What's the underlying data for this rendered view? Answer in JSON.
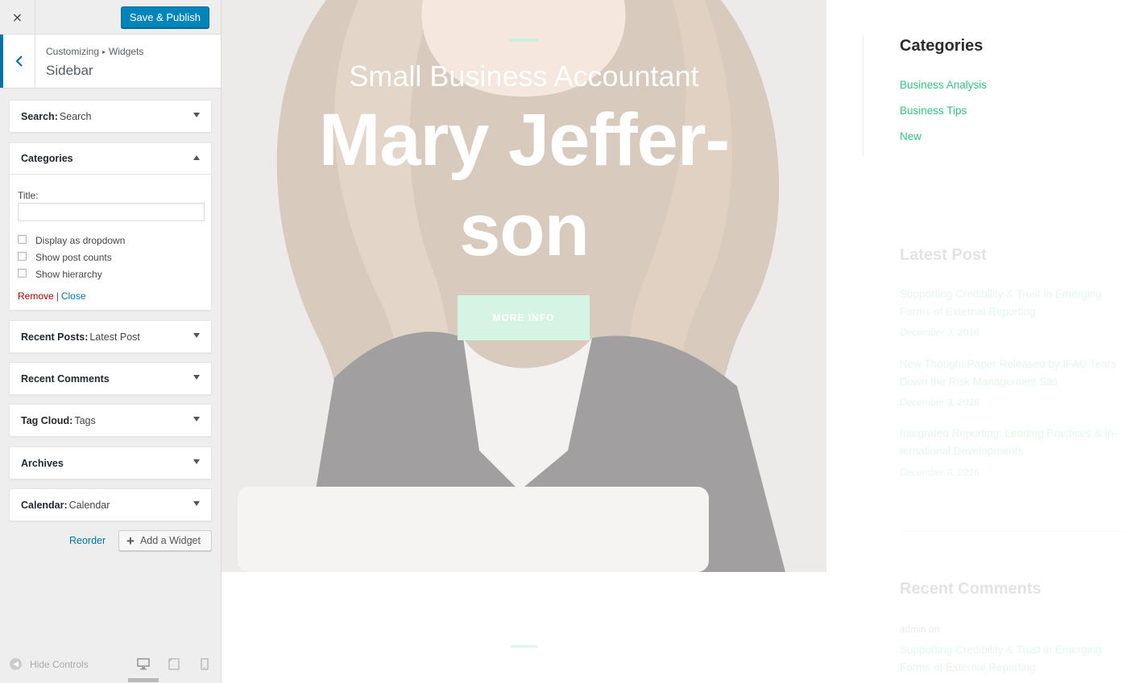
{
  "header": {
    "close_icon": "×",
    "save_label": "Save & Publish"
  },
  "section": {
    "breadcrumb_root": "Customizing",
    "breadcrumb_sep": "▸",
    "breadcrumb_child": "Widgets",
    "title": "Sidebar"
  },
  "widgets": {
    "search": {
      "type": "Search:",
      "title": "Search"
    },
    "categories": {
      "type": "Categories",
      "title_label": "Title:",
      "title_value": "",
      "options": [
        "Display as dropdown",
        "Show post counts",
        "Show hierarchy"
      ],
      "remove_label": "Remove",
      "pipe": "|",
      "close_label": "Close"
    },
    "recent_posts": {
      "type": "Recent Posts:",
      "title": "Latest Post"
    },
    "recent_comments": {
      "type": "Recent Comments",
      "title": ""
    },
    "tag_cloud": {
      "type": "Tag Cloud:",
      "title": "Tags"
    },
    "archives": {
      "type": "Archives",
      "title": ""
    },
    "calendar": {
      "type": "Calendar:",
      "title": "Calendar"
    }
  },
  "actions": {
    "reorder_label": "Reorder",
    "add_widget_label": "Add a Widget"
  },
  "footer": {
    "hide_controls_label": "Hide Controls",
    "devices": [
      "desktop-icon",
      "tablet-icon",
      "mobile-icon"
    ],
    "active_device": "desktop"
  },
  "preview": {
    "hero": {
      "subtitle": "Small Business Accountant",
      "name_line1": "Mary Jeffer-",
      "name_line2": "son",
      "button_label": "MORE INFO"
    },
    "sidebar": {
      "categories_heading": "Categories",
      "categories": [
        "Business Analysis",
        "Business Tips",
        "New"
      ],
      "latest_heading": "Latest Post",
      "posts": [
        {
          "line1": "Supporting Credibility & Trust in Emerging",
          "line2": "Forms of External Reporting",
          "date": "December 3, 2016"
        },
        {
          "line1": "New Thought Paper Released by IFAC Tears",
          "line2": "Down the Risk Management Silo",
          "date": "December 3, 2016"
        },
        {
          "line1": "Integrated Reporting: Leading Practices & In-",
          "line2": "ternational Developments",
          "date": "December 3, 2016"
        }
      ],
      "comments_heading": "Recent Comments",
      "comment_author": "admin",
      "comment_on": "on",
      "comment_line1": "Supporting Credibility & Trust in Emerging",
      "comment_line2": "Forms of External Reporting"
    }
  },
  "colors": {
    "accent": "#0085ba",
    "link_green": "#35c27e",
    "remove_red": "#aa0000"
  }
}
